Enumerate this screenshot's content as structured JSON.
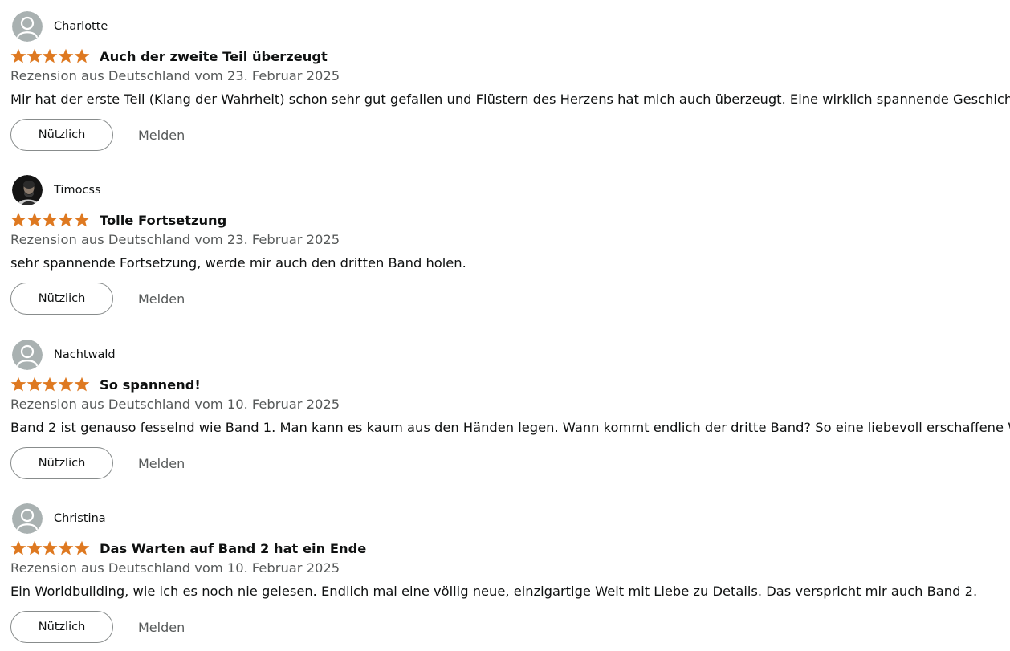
{
  "colors": {
    "star": "#de7921",
    "text": "#0f1111",
    "secondary_text": "#565959",
    "button_border": "#888c8c",
    "avatar_placeholder": "#a9b1b1"
  },
  "reviews": [
    {
      "author": "Charlotte",
      "avatar_icon": "default-user-icon",
      "rating": 5,
      "rating_max": 5,
      "title": "Auch der zweite Teil überzeugt",
      "date": "Rezension aus Deutschland vom 23. Februar 2025",
      "body": "Mir hat der erste Teil (Klang der Wahrheit) schon sehr gut gefallen und Flüstern des Herzens hat mich auch überzeugt. Eine wirklich spannende Geschichte!",
      "helpful_label": "Nützlich",
      "report_label": "Melden"
    },
    {
      "author": "Timocss",
      "avatar_icon": "photo-avatar",
      "rating": 5,
      "rating_max": 5,
      "title": "Tolle Fortsetzung",
      "date": "Rezension aus Deutschland vom 23. Februar 2025",
      "body": "sehr spannende Fortsetzung, werde mir auch den dritten Band holen.",
      "helpful_label": "Nützlich",
      "report_label": "Melden"
    },
    {
      "author": "Nachtwald",
      "avatar_icon": "default-user-icon",
      "rating": 5,
      "rating_max": 5,
      "title": "So spannend!",
      "date": "Rezension aus Deutschland vom 10. Februar 2025",
      "body": "Band 2 ist genauso fesselnd wie Band 1. Man kann es kaum aus den Händen legen. Wann kommt endlich der dritte Band? So eine liebevoll erschaffene Welt!",
      "helpful_label": "Nützlich",
      "report_label": "Melden"
    },
    {
      "author": "Christina",
      "avatar_icon": "default-user-icon",
      "rating": 5,
      "rating_max": 5,
      "title": "Das Warten auf Band 2 hat ein Ende",
      "date": "Rezension aus Deutschland vom 10. Februar 2025",
      "body": "Ein Worldbuilding, wie ich es noch nie gelesen. Endlich mal eine völlig neue, einzigartige Welt mit Liebe zu Details. Das verspricht mir auch Band 2.",
      "helpful_label": "Nützlich",
      "report_label": "Melden"
    }
  ]
}
